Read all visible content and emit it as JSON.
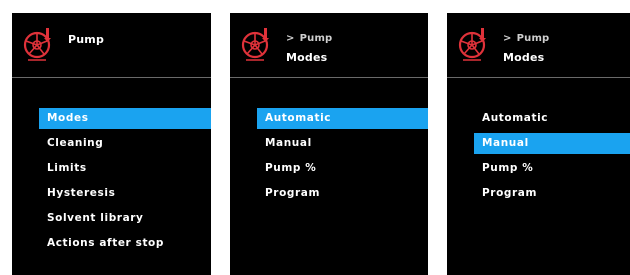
{
  "screen1": {
    "title": "Pump",
    "menu": [
      "Modes",
      "Cleaning",
      "Limits",
      "Hysteresis",
      "Solvent library",
      "Actions after stop"
    ],
    "selected_index": 0
  },
  "screen2": {
    "breadcrumb_sep": ">",
    "breadcrumb": "Pump",
    "title": "Modes",
    "menu": [
      "Automatic",
      "Manual",
      "Pump %",
      "Program"
    ],
    "selected_index": 0
  },
  "screen3": {
    "breadcrumb_sep": ">",
    "breadcrumb": "Pump",
    "title": "Modes",
    "menu": [
      "Automatic",
      "Manual",
      "Pump %",
      "Program"
    ],
    "selected_index": 1
  },
  "colors": {
    "selection": "#1aa3f0",
    "icon": "#e0323a",
    "background": "#000000"
  },
  "icons": {
    "pump": "pump-icon"
  }
}
